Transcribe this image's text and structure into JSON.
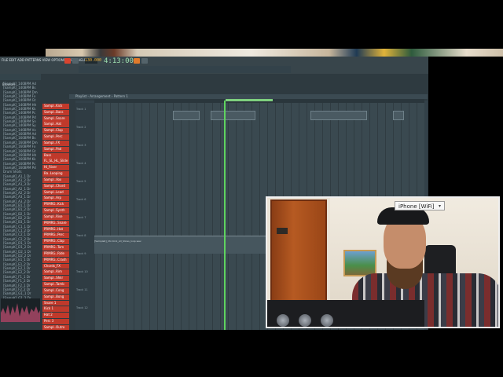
{
  "window": {
    "song_position": "4:13:00",
    "tempo": "130.000",
    "playlist_title": "Playlist - Arrangement › Pattern 1"
  },
  "browser": {
    "header": "Browser",
    "items": [
      "[SampK]_140BPM Ad",
      "[SampK]_140BPM Bs",
      "[SampK]_140BPM Dm",
      "[SampK]_140BPM Fx",
      "[SampK]_140BPM Gt",
      "[SampK]_140BPM Hh",
      "[SampK]_140BPM Kk",
      "[SampK]_140BPM Pc",
      "[SampK]_140BPM Pd",
      "[SampK]_140BPM Sn",
      "[SampK]_140BPM Sy",
      "[SampK]_140BPM Vx",
      "[SampK]_160BPM Ad",
      "[SampK]_160BPM Bs",
      "[SampK]_160BPM Dm",
      "[SampK]_160BPM Fx",
      "[SampK]_160BPM Gt",
      "[SampK]_160BPM Hh",
      "[SampK]_160BPM Kk",
      "[SampK]_160BPM Pc",
      "[SampK]_160BPM Pd",
      "Drum Shots",
      "[SampK]_A1_1 Dr",
      "[SampK]_A1_2 Dr",
      "[SampK]_A1_3 Dr",
      "[SampK]_A2_1 Dr",
      "[SampK]_A2_2 Dr",
      "[SampK]_A3_1 Dr",
      "[SampK]_A3_2 Dr",
      "[SampK]_B1_1 Dr",
      "[SampK]_B1_2 Dr",
      "[SampK]_B2_1 Dr",
      "[SampK]_B2_2 Dr",
      "[SampK]_B3_1 Dr",
      "[SampK]_C1_1 Dr",
      "[SampK]_C1_2 Dr",
      "[SampK]_C2_1 Dr",
      "[SampK]_C2_2 Dr",
      "[SampK]_D1_1 Dr",
      "[SampK]_D1_2 Dr",
      "[SampK]_D2_1 Dr",
      "[SampK]_D2_2 Dr",
      "[SampK]_E1_1 Dr",
      "[SampK]_E1_2 Dr",
      "[SampK]_E2_1 Dr",
      "[SampK]_E2_2 Dr",
      "[SampK]_F1_1 Dr",
      "[SampK]_F1_2 Dr",
      "[SampK]_F2_1 Dr",
      "[SampK]_F2_2 Dr",
      "[SampK]_G1_1 Dr",
      "[SampK]_G1_2 Dr",
      "[SampK]_G2_1 Dr"
    ]
  },
  "channels": [
    {
      "label": "Sampl..Kick",
      "color": "#c0392b"
    },
    {
      "label": "Sampl..Bass",
      "color": "#c0392b"
    },
    {
      "label": "Sampl..Snare",
      "color": "#c0392b"
    },
    {
      "label": "Sampl..Hat",
      "color": "#c0392b"
    },
    {
      "label": "Sampl..Clap",
      "color": "#c0392b"
    },
    {
      "label": "Sampl..Perc",
      "color": "#c0392b"
    },
    {
      "label": "Sampl..FX",
      "color": "#c0392b"
    },
    {
      "label": "Sampl..Pad",
      "color": "#c0392b"
    },
    {
      "label": "Bass",
      "color": "#c0392b"
    },
    {
      "label": "FL_SL_HL_Slide",
      "color": "#c0392b"
    },
    {
      "label": "Hi_Riser",
      "color": "#c0392b"
    },
    {
      "label": "Ba..Looping",
      "color": "#c0392b"
    },
    {
      "label": "Sampl..Vox",
      "color": "#c0392b"
    },
    {
      "label": "Sampl..Chord",
      "color": "#c0392b"
    },
    {
      "label": "Sampl..Lead",
      "color": "#c0392b"
    },
    {
      "label": "Sampl..Arp",
      "color": "#c0392b"
    },
    {
      "label": "PRMRG..Kick",
      "color": "#c0392b"
    },
    {
      "label": "Sampl..Synth",
      "color": "#c0392b"
    },
    {
      "label": "Sampl..Rise",
      "color": "#c0392b"
    },
    {
      "label": "PRMRG..Snare",
      "color": "#c0392b"
    },
    {
      "label": "PRMRG..Hat",
      "color": "#c0392b"
    },
    {
      "label": "PRMRG..Perc",
      "color": "#c0392b"
    },
    {
      "label": "PRMRG..Clap",
      "color": "#c0392b"
    },
    {
      "label": "PRMRG..Tom",
      "color": "#c0392b"
    },
    {
      "label": "PRMRG..Ride",
      "color": "#c0392b"
    },
    {
      "label": "PRMRG..Crash",
      "color": "#c0392b"
    },
    {
      "label": "Chords_FX",
      "color": "#c0392b"
    },
    {
      "label": "Sampl..Rim",
      "color": "#c0392b"
    },
    {
      "label": "Sampl..Shkr",
      "color": "#c0392b"
    },
    {
      "label": "Sampl..Tamb",
      "color": "#c0392b"
    },
    {
      "label": "Sampl..Cong",
      "color": "#c0392b"
    },
    {
      "label": "Sampl..Bong",
      "color": "#c0392b"
    },
    {
      "label": "Snare 1",
      "color": "#c0392b"
    },
    {
      "label": "Kick 1",
      "color": "#c0392b"
    },
    {
      "label": "Hat 2",
      "color": "#c0392b"
    },
    {
      "label": "Perc 3",
      "color": "#c0392b"
    },
    {
      "label": "Sampl..Outro",
      "color": "#c0392b"
    }
  ],
  "tracks": [
    "Track 1",
    "Track 2",
    "Track 3",
    "Track 4",
    "Track 5",
    "Track 6",
    "Track 7",
    "Track 8",
    "Track 9",
    "Track 10",
    "Track 11",
    "Track 12"
  ],
  "long_clip_text": "[SampleK]_Ctn.Kick_All_Slices_loop.wav",
  "webcam": {
    "source_label": "iPhone [WiFi]"
  },
  "colors": {
    "accent": "#5fd35f",
    "playlist_bg": "#3a4950",
    "channel_btn": "#c0392b"
  }
}
